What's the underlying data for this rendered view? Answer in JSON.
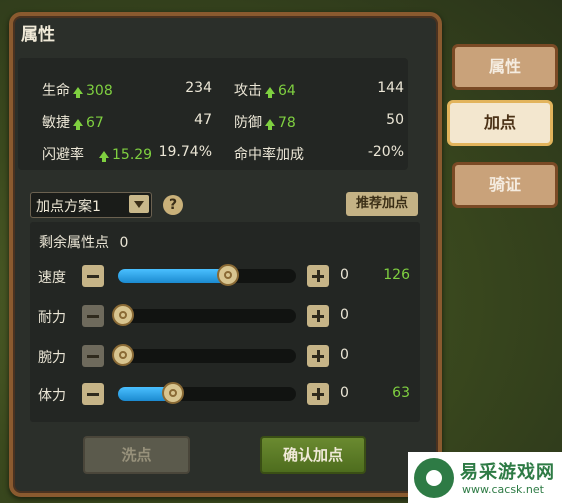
{
  "panel": {
    "title": "属性"
  },
  "stats": [
    {
      "label": "生命",
      "bonus": "308",
      "value": "234"
    },
    {
      "label": "攻击",
      "bonus": "64",
      "value": "144"
    },
    {
      "label": "敏捷",
      "bonus": "67",
      "value": "47"
    },
    {
      "label": "防御",
      "bonus": "78",
      "value": "50"
    },
    {
      "label": "闪避率",
      "bonus": "15.29",
      "value": "19.74%"
    },
    {
      "label": "命中率加成",
      "bonus": "",
      "value": "-20%"
    }
  ],
  "plan": {
    "selected": "加点方案1",
    "recommend_label": "推荐加点",
    "help_label": "?"
  },
  "remaining": {
    "label": "剩余属性点",
    "value": "0"
  },
  "attributes": [
    {
      "label": "速度",
      "points": "0",
      "total": "126",
      "level": 0.62
    },
    {
      "label": "耐力",
      "points": "0",
      "total": "",
      "level": 0.0
    },
    {
      "label": "腕力",
      "points": "0",
      "total": "",
      "level": 0.0
    },
    {
      "label": "体力",
      "points": "0",
      "total": "63",
      "level": 0.31
    }
  ],
  "buttons": {
    "reset": "洗点",
    "confirm": "确认加点"
  },
  "tabs": [
    {
      "label": "属性",
      "active": false
    },
    {
      "label": "加点",
      "active": true
    },
    {
      "label": "骑证",
      "active": false
    }
  ],
  "watermark": {
    "brand": "易采游戏网",
    "url": "www.cacsk.net"
  },
  "colors": {
    "accent_green": "#7fd040",
    "slider_blue": "#2aa6ee",
    "frame_brown": "#8a5a2f"
  }
}
